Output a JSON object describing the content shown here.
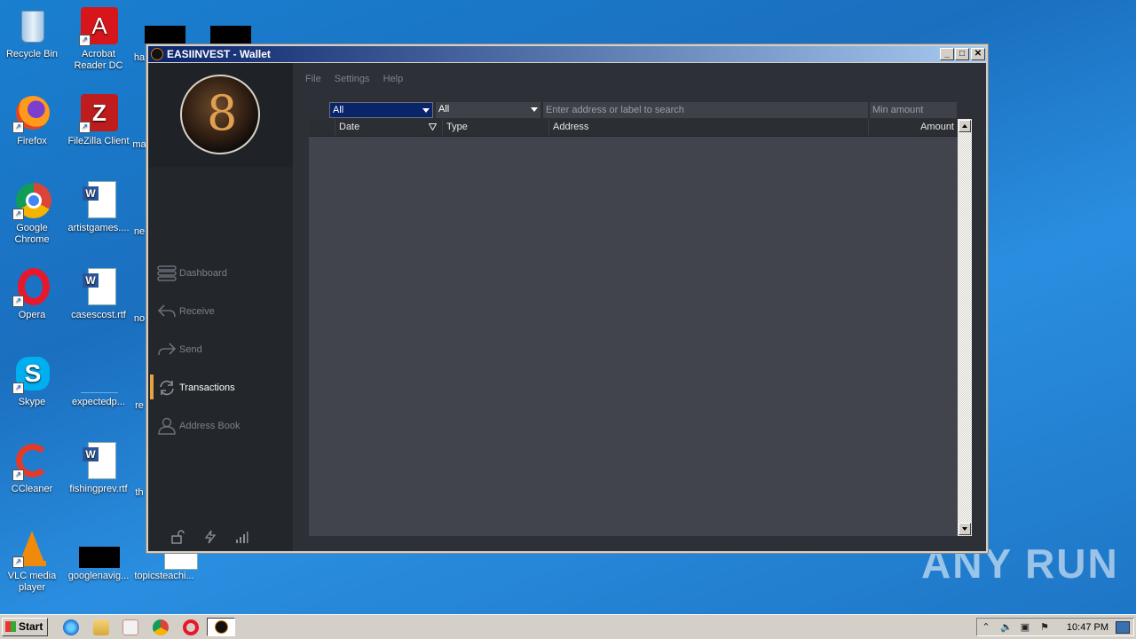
{
  "desktop": {
    "icons": [
      {
        "label": "Recycle Bin"
      },
      {
        "label": "Acrobat Reader DC"
      },
      {
        "label": "Firefox"
      },
      {
        "label": "FileZilla Client"
      },
      {
        "label": "Google Chrome"
      },
      {
        "label": "artistgames...."
      },
      {
        "label": "Opera"
      },
      {
        "label": "casescost.rtf"
      },
      {
        "label": "Skype"
      },
      {
        "label": "expectedp..."
      },
      {
        "label": "CCleaner"
      },
      {
        "label": "fishingprev.rtf"
      },
      {
        "label": "VLC media player"
      },
      {
        "label": "googlenavig..."
      },
      {
        "label": "topicsteachi..."
      }
    ],
    "partial_labels": [
      "ha",
      "ma",
      "ne",
      "no",
      "re",
      "th"
    ],
    "watermark": "ANY RUN"
  },
  "window": {
    "title": "EASIINVEST - Wallet",
    "menu": [
      "File",
      "Settings",
      "Help"
    ],
    "nav": [
      {
        "label": "Dashboard",
        "icon": "stack-icon",
        "active": false
      },
      {
        "label": "Receive",
        "icon": "receive-arrow-icon",
        "active": false
      },
      {
        "label": "Send",
        "icon": "send-arrow-icon",
        "active": false
      },
      {
        "label": "Transactions",
        "icon": "refresh-icon",
        "active": true
      },
      {
        "label": "Address Book",
        "icon": "person-icon",
        "active": false
      }
    ],
    "filters": {
      "date_filter": "All",
      "type_filter": "All",
      "search_placeholder": "Enter address or label to search",
      "min_amount_placeholder": "Min amount"
    },
    "table": {
      "columns": [
        "Date",
        "Type",
        "Address",
        "Amount"
      ],
      "rows": []
    },
    "accent_color": "#e8a040"
  },
  "taskbar": {
    "start_label": "Start",
    "clock": "10:47 PM"
  }
}
